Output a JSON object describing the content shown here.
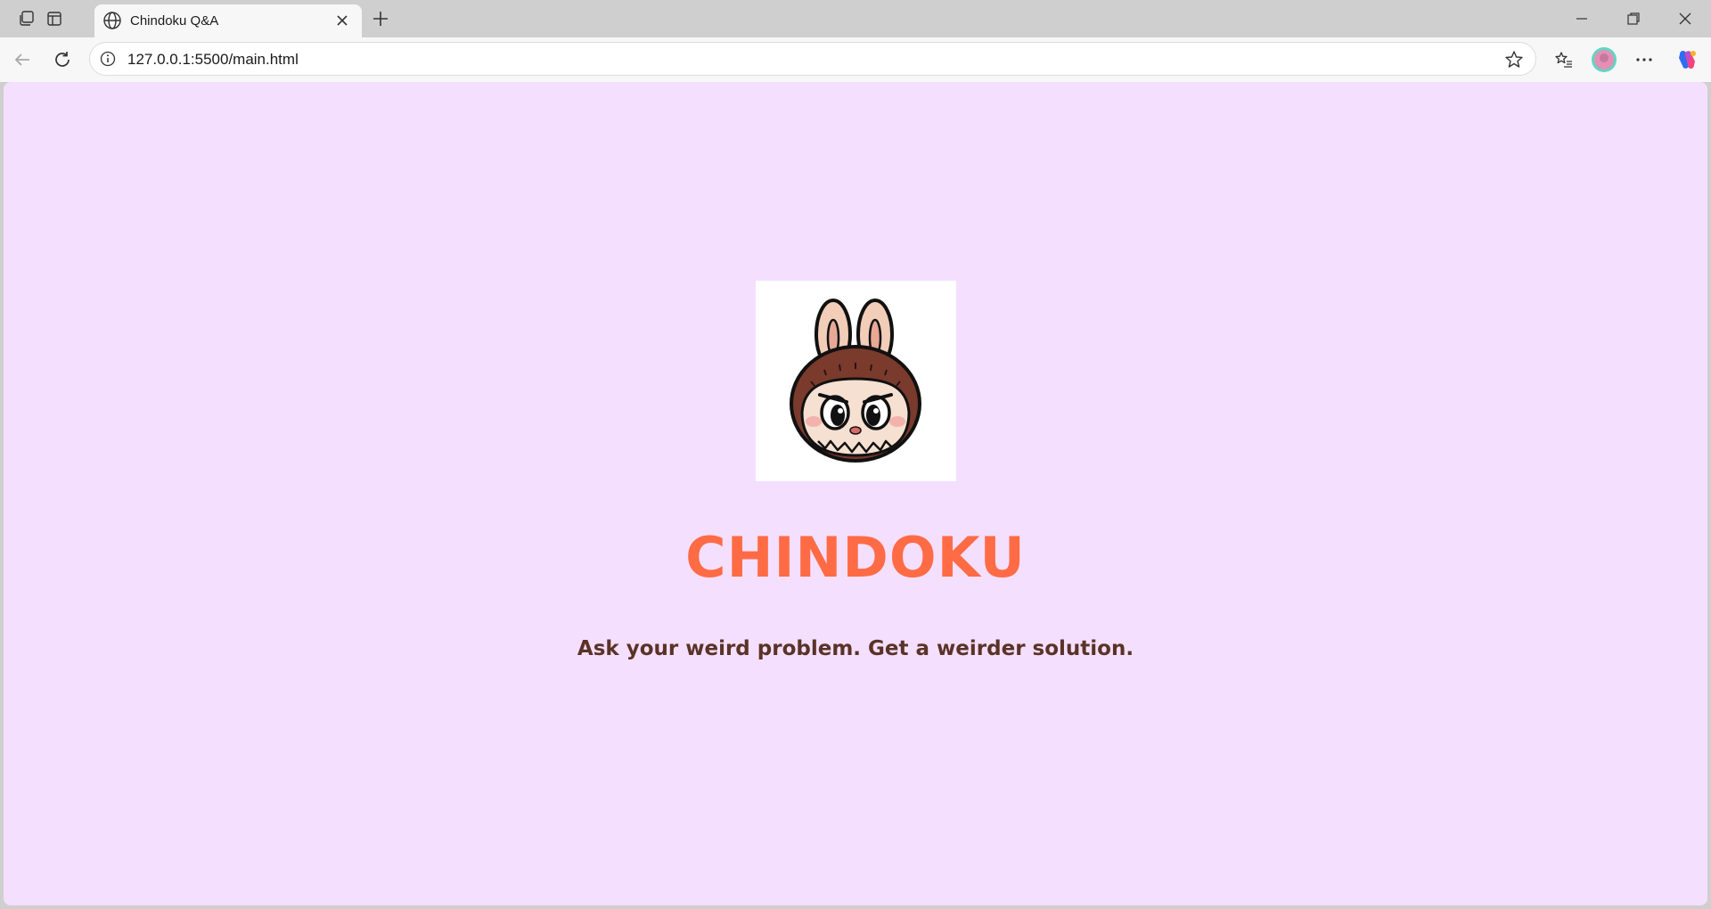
{
  "browser": {
    "tab_title": "Chindoku Q&A",
    "url": "127.0.0.1:5500/main.html"
  },
  "page": {
    "logo_alt": "Labubu mascot",
    "title": "CHINDOKU",
    "tagline": "Ask your weird problem. Get a weirder solution.",
    "colors": {
      "background": "#f5dfff",
      "title": "#ff6b45",
      "tagline": "#5a3328"
    }
  }
}
